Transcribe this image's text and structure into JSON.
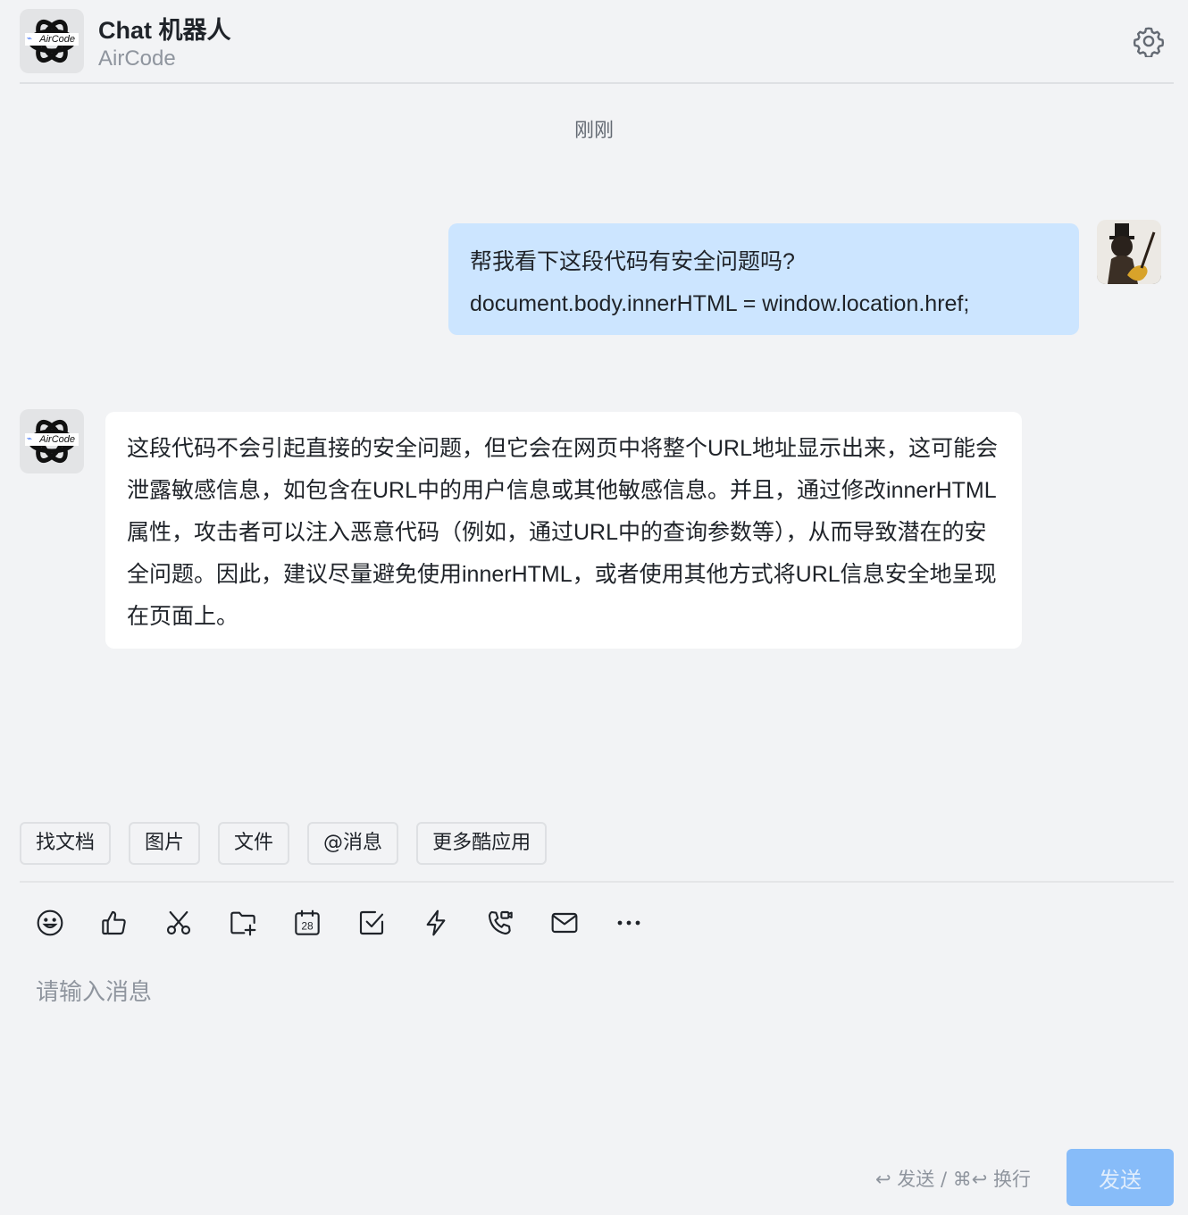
{
  "header": {
    "title": "Chat 机器人",
    "subtitle": "AirCode",
    "avatar_text": "AirCode",
    "settings_icon": "gear-icon"
  },
  "chat": {
    "timestamp": "刚刚",
    "user_message": {
      "lines": [
        "帮我看下这段代码有安全问题吗?",
        "document.body.innerHTML = window.location.href;"
      ]
    },
    "bot_message": {
      "avatar_text": "AirCode",
      "text": "这段代码不会引起直接的安全问题，但它会在网页中将整个URL地址显示出来，这可能会泄露敏感信息，如包含在URL中的用户信息或其他敏感信息。并且，通过修改innerHTML属性，攻击者可以注入恶意代码（例如，通过URL中的查询参数等），从而导致潜在的安全问题。因此，建议尽量避免使用innerHTML，或者使用其他方式将URL信息安全地呈现在页面上。"
    }
  },
  "quick_actions": [
    "找文档",
    "图片",
    "文件",
    "@消息",
    "更多酷应用"
  ],
  "toolbar": {
    "icons": [
      "emoji-icon",
      "thumbs-up-icon",
      "scissors-icon",
      "folder-add-icon",
      "calendar-icon",
      "checkbox-icon",
      "lightning-icon",
      "phone-video-icon",
      "mail-icon",
      "more-icon"
    ],
    "calendar_day": "28"
  },
  "input": {
    "placeholder": "请输入消息",
    "value": ""
  },
  "footer": {
    "hint": "↩ 发送 / ⌘↩ 换行",
    "send_label": "发送"
  },
  "colors": {
    "user_bubble": "#cce5ff",
    "send_button": "#87bcf9",
    "background": "#f2f3f5"
  }
}
